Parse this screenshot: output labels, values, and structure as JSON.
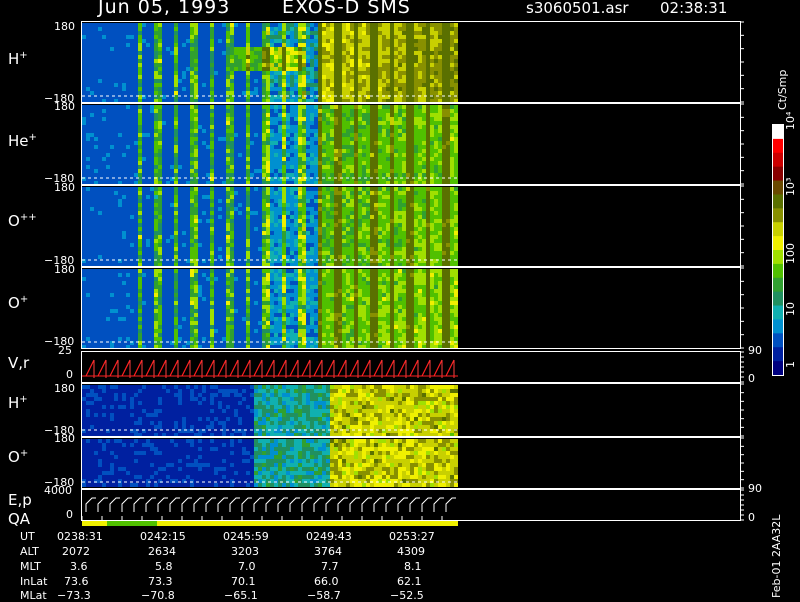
{
  "header": {
    "date": "Jun 05, 1993",
    "instrument": "EXOS-D SMS",
    "file": "s3060501.asr",
    "time": "02:38:31"
  },
  "panels": [
    {
      "label": "H",
      "sup": "+",
      "top_tick": "180",
      "bottom_tick": "−180"
    },
    {
      "label": "He",
      "sup": "+",
      "top_tick": "180",
      "bottom_tick": "−180"
    },
    {
      "label": "O",
      "sup": "++",
      "top_tick": "180",
      "bottom_tick": "−180"
    },
    {
      "label": "O",
      "sup": "+",
      "top_tick": "180",
      "bottom_tick": "−180"
    },
    {
      "label": "V,r",
      "sup": "",
      "top_tick": "25",
      "bottom_tick": "0",
      "right_top": "90",
      "right_bottom": "0"
    },
    {
      "label": "H",
      "sup": "+",
      "top_tick": "180",
      "bottom_tick": "−180"
    },
    {
      "label": "O",
      "sup": "+",
      "top_tick": "180",
      "bottom_tick": "−180"
    },
    {
      "label": "E,p",
      "sup": "",
      "top_tick": "4000",
      "bottom_tick": "0",
      "right_top": "90",
      "right_bottom": "0"
    }
  ],
  "qa_label": "QA",
  "colorbar": {
    "units": "Ct/Smp",
    "tick_labels": [
      "10⁴",
      "10³",
      "100",
      "10",
      "1"
    ],
    "colors": [
      "#ffffff",
      "#ff0000",
      "#cc0000",
      "#880000",
      "#6a4a00",
      "#5a7000",
      "#889000",
      "#c8d000",
      "#f0f000",
      "#a0e000",
      "#50c000",
      "#30a030",
      "#209060",
      "#10b0b0",
      "#0090d0",
      "#0050c0",
      "#0020a0",
      "#000080"
    ]
  },
  "footer": {
    "rows": [
      {
        "label": "UT",
        "values": [
          "0238:31",
          "0242:15",
          "0245:59",
          "0249:43",
          "0253:27"
        ]
      },
      {
        "label": "ALT",
        "values": [
          "2072",
          "2634",
          "3203",
          "3764",
          "4309"
        ]
      },
      {
        "label": "MLT",
        "values": [
          "3.6",
          "5.8",
          "7.0",
          "7.7",
          "8.1"
        ]
      },
      {
        "label": "InLat",
        "values": [
          "73.6",
          "73.3",
          "70.1",
          "66.0",
          "62.1"
        ]
      },
      {
        "label": "MLat",
        "values": [
          "−73.3",
          "−70.8",
          "−65.1",
          "−58.7",
          "−52.5"
        ]
      }
    ],
    "id_text": "Feb-01 2AA32L"
  }
}
